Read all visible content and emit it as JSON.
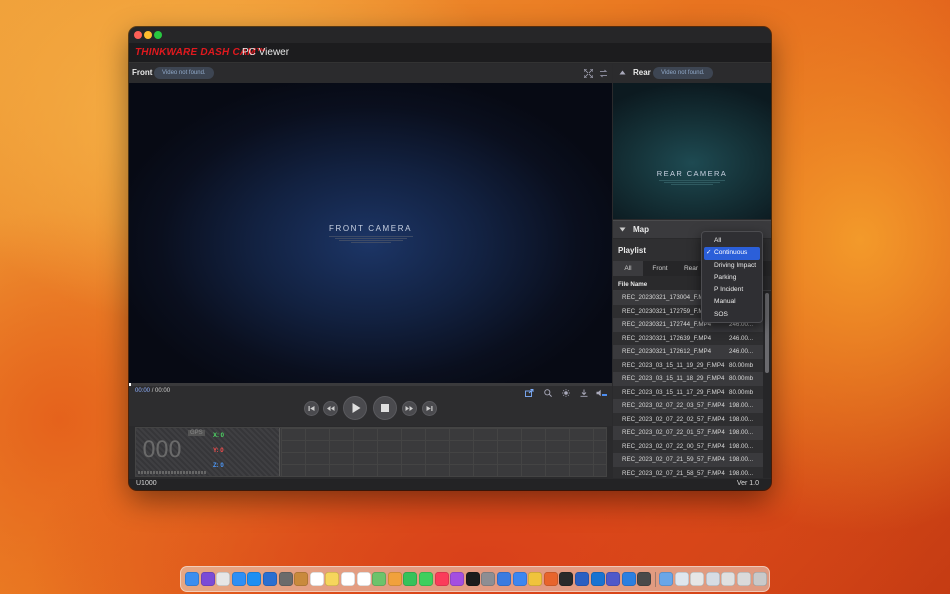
{
  "app": {
    "brand": "THINKWARE DASH CAM™",
    "subtitle": "PC Viewer"
  },
  "front": {
    "label": "Front",
    "status_pill": "Video not found.",
    "camera_title": "FRONT CAMERA",
    "camera_sub_lines": [
      "",
      "",
      "",
      ""
    ]
  },
  "rear": {
    "label": "Rear",
    "status_pill": "Video not found.",
    "camera_title": "REAR CAMERA"
  },
  "map": {
    "label": "Map"
  },
  "playback": {
    "current_time": "00:00",
    "total_time": "/ 00:00"
  },
  "sensor": {
    "gps_label": "GPS",
    "speed": "000",
    "x": "X: 0",
    "y": "Y: 0",
    "z": "Z: 0"
  },
  "playlist": {
    "title": "Playlist",
    "tabs": [
      "All",
      "Front",
      "Rear"
    ],
    "column_file": "File Name",
    "files": [
      {
        "name": "REC_20230321_173004_F.MP4",
        "size": ""
      },
      {
        "name": "REC_20230321_172759_F.MP4",
        "size": ""
      },
      {
        "name": "REC_20230321_172744_F.MP4",
        "size": "246.00..."
      },
      {
        "name": "REC_20230321_172639_F.MP4",
        "size": "246.00..."
      },
      {
        "name": "REC_20230321_172612_F.MP4",
        "size": "246.00..."
      },
      {
        "name": "REC_2023_03_15_11_19_29_F.MP4",
        "size": "80.00mb"
      },
      {
        "name": "REC_2023_03_15_11_18_29_F.MP4",
        "size": "80.00mb"
      },
      {
        "name": "REC_2023_03_15_11_17_29_F.MP4",
        "size": "80.00mb"
      },
      {
        "name": "REC_2023_02_07_22_03_57_F.MP4",
        "size": "198.00..."
      },
      {
        "name": "REC_2023_02_07_22_02_57_F.MP4",
        "size": "198.00..."
      },
      {
        "name": "REC_2023_02_07_22_01_57_F.MP4",
        "size": "198.00..."
      },
      {
        "name": "REC_2023_02_07_22_00_57_F.MP4",
        "size": "198.00..."
      },
      {
        "name": "REC_2023_02_07_21_59_57_F.MP4",
        "size": "198.00..."
      },
      {
        "name": "REC_2023_02_07_21_58_57_F.MP4",
        "size": "198.00..."
      }
    ]
  },
  "filter_dropdown": {
    "options": [
      "All",
      "Continuous",
      "Driving Impact",
      "Parking",
      "P Incident",
      "Manual",
      "SOS"
    ],
    "selected": "Continuous",
    "check_glyph": "✓"
  },
  "status": {
    "model": "U1000",
    "version": "Ver 1.0"
  },
  "colors": {
    "brand_red": "#e0191e",
    "accent_blue": "#2b5fd9",
    "sensor_x": "#4cd964",
    "sensor_y": "#ff4d4d",
    "sensor_z": "#4d9bff"
  },
  "dock": {
    "icons": [
      {
        "name": "finder-icon",
        "color": "#3b8ef0"
      },
      {
        "name": "siri-icon",
        "color": "#7b4bd6"
      },
      {
        "name": "launchpad-icon",
        "color": "#e6e6e6"
      },
      {
        "name": "safari-icon",
        "color": "#2f8ff5"
      },
      {
        "name": "appstore-icon",
        "color": "#1d8ff2"
      },
      {
        "name": "xcode-icon",
        "color": "#2a6fd1"
      },
      {
        "name": "unknown-app-icon",
        "color": "#6b6b6b"
      },
      {
        "name": "amber-app-icon",
        "color": "#c98a3c"
      },
      {
        "name": "calendar-icon",
        "color": "#ffffff"
      },
      {
        "name": "notes-icon",
        "color": "#f6d55c"
      },
      {
        "name": "freeform-icon",
        "color": "#ffffff"
      },
      {
        "name": "reminders-icon",
        "color": "#ffffff"
      },
      {
        "name": "maps-icon",
        "color": "#6dc36b"
      },
      {
        "name": "photos-icon",
        "color": "#f1a13c"
      },
      {
        "name": "facetime-icon",
        "color": "#36c25a"
      },
      {
        "name": "messages-icon",
        "color": "#3fcf5d"
      },
      {
        "name": "music-icon",
        "color": "#fb3c5a"
      },
      {
        "name": "podcasts-icon",
        "color": "#a44ee0"
      },
      {
        "name": "appletv-icon",
        "color": "#1c1c1c"
      },
      {
        "name": "system-settings-icon",
        "color": "#8e8e93"
      },
      {
        "name": "pencil-app-icon",
        "color": "#3a7be0"
      },
      {
        "name": "keynote-icon",
        "color": "#3e86f0"
      },
      {
        "name": "chrome-icon",
        "color": "#f0c33c"
      },
      {
        "name": "firefox-icon",
        "color": "#e8642c"
      },
      {
        "name": "terminal-icon",
        "color": "#2a2a2a"
      },
      {
        "name": "word-icon",
        "color": "#2b5fc2"
      },
      {
        "name": "outlook-icon",
        "color": "#1a73d1"
      },
      {
        "name": "teams-icon",
        "color": "#5059c9"
      },
      {
        "name": "xcode-alt-icon",
        "color": "#2c7fe0"
      },
      {
        "name": "thinkware-viewer-icon",
        "color": "#4a4a4a"
      },
      {
        "name": "downloads-folder-icon",
        "color": "#6aa6e8"
      },
      {
        "name": "preview-doc-icon",
        "color": "#dfe6ee"
      },
      {
        "name": "window-thumb-icon",
        "color": "#e6e6e6"
      },
      {
        "name": "window-thumb-2-icon",
        "color": "#d6dce4"
      },
      {
        "name": "window-thumb-3-icon",
        "color": "#e0e0e0"
      },
      {
        "name": "window-thumb-4-icon",
        "color": "#dadada"
      },
      {
        "name": "trash-icon",
        "color": "#c9c9c9"
      }
    ]
  }
}
